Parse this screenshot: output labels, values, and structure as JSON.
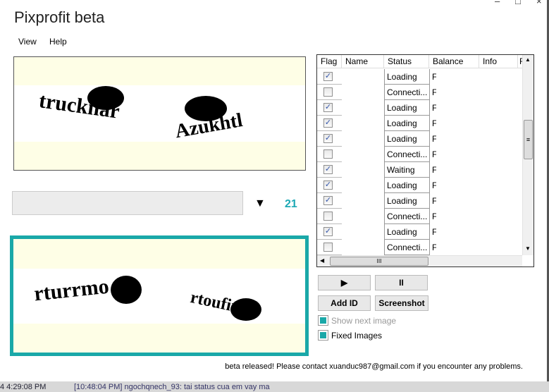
{
  "window": {
    "title": "Pixprofit beta",
    "controls": [
      "–",
      "□",
      "×"
    ]
  },
  "menu": [
    {
      "label": "View"
    },
    {
      "label": "Help"
    }
  ],
  "captcha_top": {
    "words": [
      "trucknar",
      "Azukhtl"
    ]
  },
  "captcha_bottom": {
    "words": [
      "rturrmo",
      "rtoufiu"
    ]
  },
  "answer_input": {
    "value": "",
    "placeholder": ""
  },
  "dropdown_icon": "triangle-down",
  "counter": "21",
  "accent_color": "#1aa8a8",
  "grid": {
    "columns": [
      "Flag",
      "Name",
      "Status",
      "Balance",
      "Info",
      "F"
    ],
    "rows": [
      {
        "flag": true,
        "status": "Loading",
        "balance": "F"
      },
      {
        "flag": false,
        "status": "Connecti...",
        "balance": "F"
      },
      {
        "flag": true,
        "status": "Loading",
        "balance": "F"
      },
      {
        "flag": true,
        "status": "Loading",
        "balance": "F"
      },
      {
        "flag": true,
        "status": "Loading",
        "balance": "F"
      },
      {
        "flag": false,
        "status": "Connecti...",
        "balance": "F"
      },
      {
        "flag": true,
        "status": "Waiting",
        "balance": "F"
      },
      {
        "flag": true,
        "status": "Loading",
        "balance": "F"
      },
      {
        "flag": true,
        "status": "Loading",
        "balance": "F"
      },
      {
        "flag": false,
        "status": "Connecti...",
        "balance": "F"
      },
      {
        "flag": true,
        "status": "Loading",
        "balance": "F"
      },
      {
        "flag": false,
        "status": "Connecti...",
        "balance": "F"
      }
    ]
  },
  "buttons": {
    "play": "▶",
    "pause": "II",
    "add_id": "Add ID",
    "screenshot": "Screenshot"
  },
  "options": {
    "show_next_image": {
      "label": "Show next image",
      "checked": true,
      "enabled": false
    },
    "fixed_images": {
      "label": "Fixed Images",
      "checked": true,
      "enabled": true
    }
  },
  "status_message": "beta released! Please contact xuanduc987@gmail.com if you encounter any problems.",
  "background": {
    "time": "4 4:29:08 PM",
    "chat": "[10:48:04 PM] ngochqnech_93: tai status cua em vay ma"
  }
}
